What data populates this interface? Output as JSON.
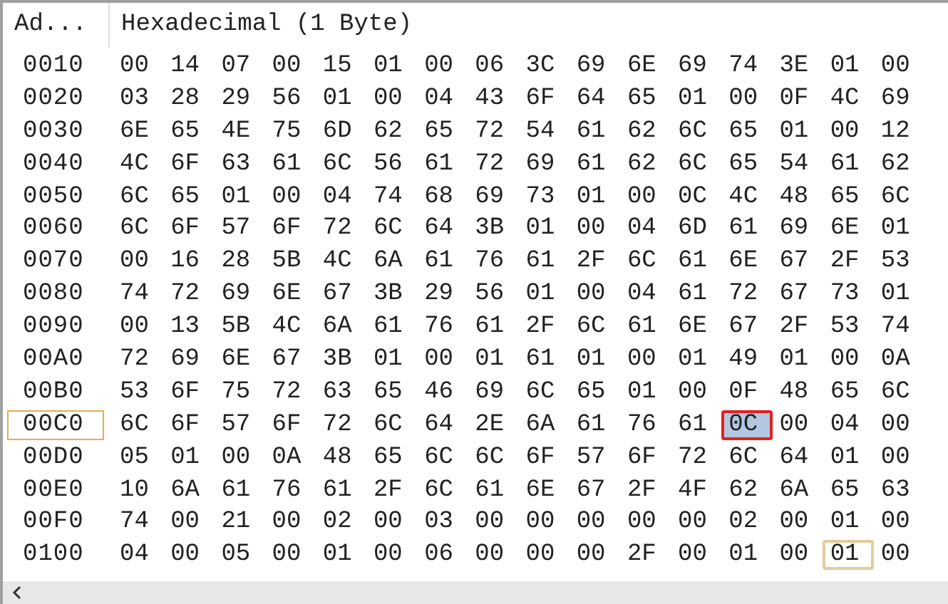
{
  "header": {
    "address_column": "Ad...",
    "data_column": "Hexadecimal (1 Byte)"
  },
  "rows": [
    {
      "address": "0010",
      "current": false,
      "bytes": [
        "00",
        "14",
        "07",
        "00",
        "15",
        "01",
        "00",
        "06",
        "3C",
        "69",
        "6E",
        "69",
        "74",
        "3E",
        "01",
        "00"
      ]
    },
    {
      "address": "0020",
      "current": false,
      "bytes": [
        "03",
        "28",
        "29",
        "56",
        "01",
        "00",
        "04",
        "43",
        "6F",
        "64",
        "65",
        "01",
        "00",
        "0F",
        "4C",
        "69"
      ]
    },
    {
      "address": "0030",
      "current": false,
      "bytes": [
        "6E",
        "65",
        "4E",
        "75",
        "6D",
        "62",
        "65",
        "72",
        "54",
        "61",
        "62",
        "6C",
        "65",
        "01",
        "00",
        "12"
      ]
    },
    {
      "address": "0040",
      "current": false,
      "bytes": [
        "4C",
        "6F",
        "63",
        "61",
        "6C",
        "56",
        "61",
        "72",
        "69",
        "61",
        "62",
        "6C",
        "65",
        "54",
        "61",
        "62"
      ]
    },
    {
      "address": "0050",
      "current": false,
      "bytes": [
        "6C",
        "65",
        "01",
        "00",
        "04",
        "74",
        "68",
        "69",
        "73",
        "01",
        "00",
        "0C",
        "4C",
        "48",
        "65",
        "6C"
      ]
    },
    {
      "address": "0060",
      "current": false,
      "bytes": [
        "6C",
        "6F",
        "57",
        "6F",
        "72",
        "6C",
        "64",
        "3B",
        "01",
        "00",
        "04",
        "6D",
        "61",
        "69",
        "6E",
        "01"
      ]
    },
    {
      "address": "0070",
      "current": false,
      "bytes": [
        "00",
        "16",
        "28",
        "5B",
        "4C",
        "6A",
        "61",
        "76",
        "61",
        "2F",
        "6C",
        "61",
        "6E",
        "67",
        "2F",
        "53"
      ]
    },
    {
      "address": "0080",
      "current": false,
      "bytes": [
        "74",
        "72",
        "69",
        "6E",
        "67",
        "3B",
        "29",
        "56",
        "01",
        "00",
        "04",
        "61",
        "72",
        "67",
        "73",
        "01"
      ]
    },
    {
      "address": "0090",
      "current": false,
      "bytes": [
        "00",
        "13",
        "5B",
        "4C",
        "6A",
        "61",
        "76",
        "61",
        "2F",
        "6C",
        "61",
        "6E",
        "67",
        "2F",
        "53",
        "74"
      ]
    },
    {
      "address": "00A0",
      "current": false,
      "bytes": [
        "72",
        "69",
        "6E",
        "67",
        "3B",
        "01",
        "00",
        "01",
        "61",
        "01",
        "00",
        "01",
        "49",
        "01",
        "00",
        "0A"
      ]
    },
    {
      "address": "00B0",
      "current": false,
      "bytes": [
        "53",
        "6F",
        "75",
        "72",
        "63",
        "65",
        "46",
        "69",
        "6C",
        "65",
        "01",
        "00",
        "0F",
        "48",
        "65",
        "6C"
      ]
    },
    {
      "address": "00C0",
      "current": true,
      "bytes": [
        "6C",
        "6F",
        "57",
        "6F",
        "72",
        "6C",
        "64",
        "2E",
        "6A",
        "61",
        "76",
        "61",
        {
          "text": "0C",
          "selected": true,
          "outlined": true
        },
        "00",
        "04",
        "00"
      ]
    },
    {
      "address": "00D0",
      "current": false,
      "bytes": [
        "05",
        "01",
        "00",
        "0A",
        "48",
        "65",
        "6C",
        "6C",
        "6F",
        "57",
        "6F",
        "72",
        "6C",
        "64",
        "01",
        "00"
      ]
    },
    {
      "address": "00E0",
      "current": false,
      "bytes": [
        "10",
        "6A",
        "61",
        "76",
        "61",
        "2F",
        "6C",
        "61",
        "6E",
        "67",
        "2F",
        "4F",
        "62",
        "6A",
        "65",
        "63"
      ]
    },
    {
      "address": "00F0",
      "current": false,
      "bytes": [
        "74",
        "00",
        "21",
        "00",
        "02",
        "00",
        "03",
        "00",
        "00",
        "00",
        "00",
        "00",
        "02",
        "00",
        "01",
        "00"
      ]
    },
    {
      "address": "0100",
      "current": false,
      "bytes": [
        "04",
        "00",
        "05",
        "00",
        "01",
        "00",
        "06",
        "00",
        "00",
        "00",
        "2F",
        "00",
        "01",
        "00",
        {
          "text": "01",
          "cursor": true
        },
        "00"
      ]
    }
  ]
}
